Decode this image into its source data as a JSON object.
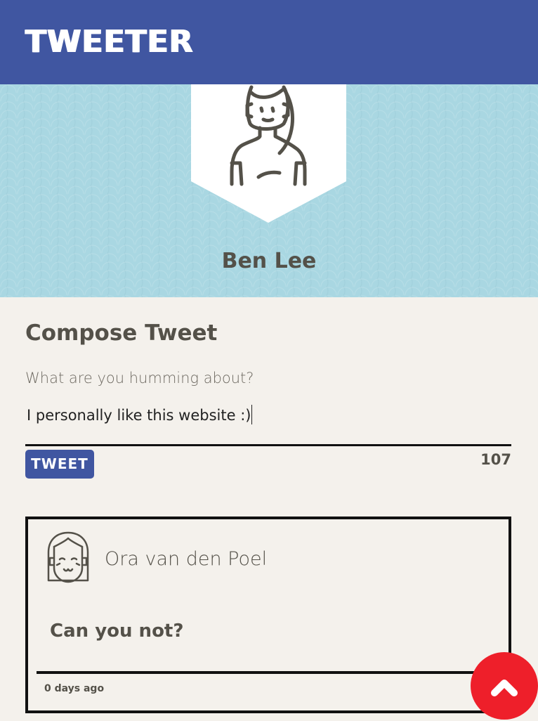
{
  "nav": {
    "brand": "TWEETER",
    "bar_color": "#4056a1"
  },
  "profile": {
    "name": "Ben Lee",
    "avatar_icon": "woman-avatar-icon",
    "hero_color": "#a9d7e2"
  },
  "compose": {
    "title": "Compose Tweet",
    "placeholder": "What are you humming about?",
    "value": "I personally like this website :)",
    "button_label": "TWEET",
    "char_counter": "107"
  },
  "tweets": [
    {
      "author": "Ora van den Poel",
      "avatar_icon": "girl-avatar-icon",
      "content": "Can you not?",
      "timestamp": "0 days ago"
    }
  ],
  "scroll_top": {
    "icon": "chevron-up-icon",
    "color": "#ee1f2a"
  }
}
